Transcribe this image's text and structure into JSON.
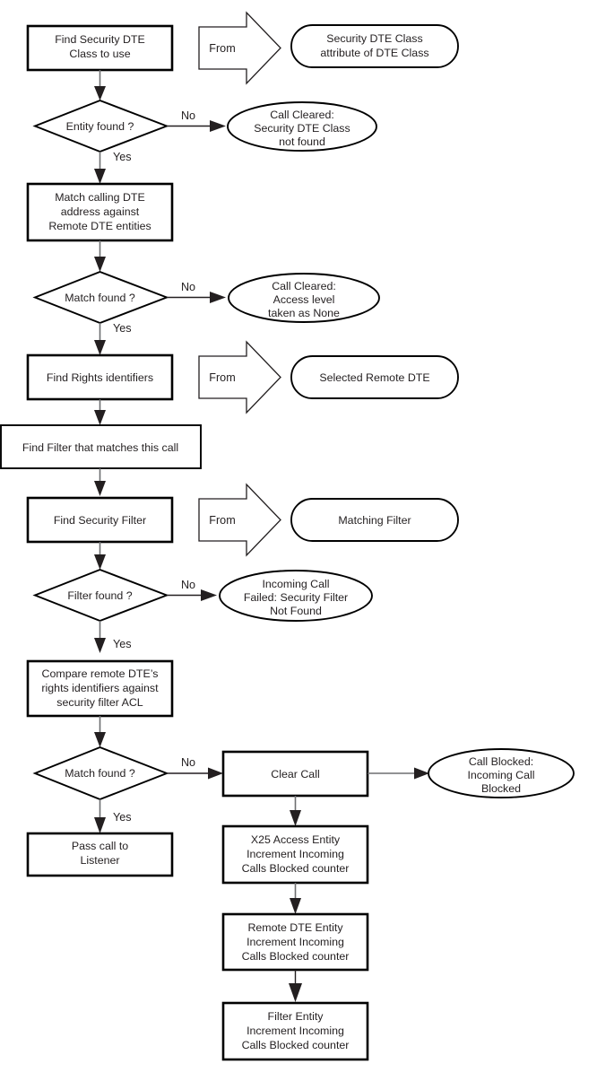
{
  "diagram": {
    "title": "Incoming call security check flowchart",
    "colors": {
      "stroke": "#000000",
      "text": "#231f20",
      "connector": "#6d6e71",
      "background": "#ffffff"
    },
    "edge_labels": {
      "no": "No",
      "yes": "Yes",
      "from": "From"
    },
    "nodes": [
      {
        "id": "find-security-dte-class",
        "type": "process",
        "lines": [
          "Find Security DTE",
          "Class to use"
        ]
      },
      {
        "id": "source-security-dte-class-attribute",
        "type": "source",
        "lines": [
          "Security DTE Class",
          "attribute of DTE Class"
        ]
      },
      {
        "id": "entity-found",
        "type": "decision",
        "lines": [
          "Entity found ?"
        ]
      },
      {
        "id": "call-cleared-class-not-found",
        "type": "terminator",
        "lines": [
          "Call Cleared:",
          "Security DTE Class",
          "not found"
        ]
      },
      {
        "id": "match-calling-dte-address",
        "type": "process",
        "lines": [
          "Match calling DTE",
          "address against",
          "Remote DTE entities"
        ]
      },
      {
        "id": "match-found-1",
        "type": "decision",
        "lines": [
          "Match found ?"
        ]
      },
      {
        "id": "call-cleared-access-none",
        "type": "terminator",
        "lines": [
          "Call Cleared:",
          "Access level",
          "taken as None"
        ]
      },
      {
        "id": "find-rights-identifiers",
        "type": "process",
        "lines": [
          "Find Rights identifiers"
        ]
      },
      {
        "id": "source-selected-remote-dte",
        "type": "source",
        "lines": [
          "Selected Remote DTE"
        ]
      },
      {
        "id": "find-filter-matching-call",
        "type": "process",
        "lines": [
          "Find Filter that matches this call"
        ]
      },
      {
        "id": "find-security-filter",
        "type": "process",
        "lines": [
          "Find Security Filter"
        ]
      },
      {
        "id": "source-matching-filter",
        "type": "source",
        "lines": [
          "Matching Filter"
        ]
      },
      {
        "id": "filter-found",
        "type": "decision",
        "lines": [
          "Filter found ?"
        ]
      },
      {
        "id": "incoming-call-failed",
        "type": "terminator",
        "lines": [
          "Incoming Call",
          "Failed:  Security Filter",
          "Not Found"
        ]
      },
      {
        "id": "compare-rights-identifiers",
        "type": "process",
        "lines": [
          "Compare remote DTE’s",
          "rights identifiers against",
          "security filter ACL"
        ]
      },
      {
        "id": "match-found-2",
        "type": "decision",
        "lines": [
          "Match found ?"
        ]
      },
      {
        "id": "clear-call",
        "type": "process",
        "lines": [
          "Clear Call"
        ]
      },
      {
        "id": "call-blocked",
        "type": "terminator",
        "lines": [
          "Call Blocked:",
          "Incoming Call",
          "Blocked"
        ]
      },
      {
        "id": "pass-call-to-listener",
        "type": "process",
        "lines": [
          "Pass call to",
          "Listener"
        ]
      },
      {
        "id": "x25-access-entity-counter",
        "type": "process",
        "lines": [
          "X25 Access Entity",
          "Increment Incoming",
          "Calls Blocked counter"
        ]
      },
      {
        "id": "remote-dte-entity-counter",
        "type": "process",
        "lines": [
          "Remote DTE Entity",
          "Increment Incoming",
          "Calls Blocked counter"
        ]
      },
      {
        "id": "filter-entity-counter",
        "type": "process",
        "lines": [
          "Filter Entity",
          "Increment Incoming",
          "Calls Blocked counter"
        ]
      }
    ]
  },
  "text": {
    "n0l0": "Find Security DTE",
    "n0l1": "Class to use",
    "n1l0": "Security DTE Class",
    "n1l1": "attribute of DTE Class",
    "n2l0": "Entity found ?",
    "n3l0": "Call Cleared:",
    "n3l1": "Security DTE Class",
    "n3l2": "not found",
    "n4l0": "Match calling DTE",
    "n4l1": "address against",
    "n4l2": "Remote DTE entities",
    "n5l0": "Match found ?",
    "n6l0": "Call Cleared:",
    "n6l1": "Access level",
    "n6l2": "taken as None",
    "n7l0": "Find Rights identifiers",
    "n8l0": "Selected Remote DTE",
    "n9l0": "Find Filter that matches this call",
    "n10l0": "Find Security Filter",
    "n11l0": "Matching Filter",
    "n12l0": "Filter found ?",
    "n13l0": "Incoming Call",
    "n13l1": "Failed:  Security Filter",
    "n13l2": "Not Found",
    "n14l0": "Compare remote DTE’s",
    "n14l1": "rights identifiers against",
    "n14l2": "security filter ACL",
    "n15l0": "Match found ?",
    "n16l0": "Clear Call",
    "n17l0": "Call Blocked:",
    "n17l1": "Incoming Call",
    "n17l2": "Blocked",
    "n18l0": "Pass call to",
    "n18l1": "Listener",
    "n19l0": "X25 Access Entity",
    "n19l1": "Increment Incoming",
    "n19l2": "Calls Blocked counter",
    "n20l0": "Remote DTE Entity",
    "n20l1": "Increment Incoming",
    "n20l2": "Calls Blocked counter",
    "n21l0": "Filter Entity",
    "n21l1": "Increment Incoming",
    "n21l2": "Calls Blocked counter",
    "from1": "From",
    "from2": "From",
    "from3": "From",
    "no1": "No",
    "no2": "No",
    "no3": "No",
    "no4": "No",
    "yes1": "Yes",
    "yes2": "Yes",
    "yes3": "Yes",
    "yes4": "Yes"
  }
}
